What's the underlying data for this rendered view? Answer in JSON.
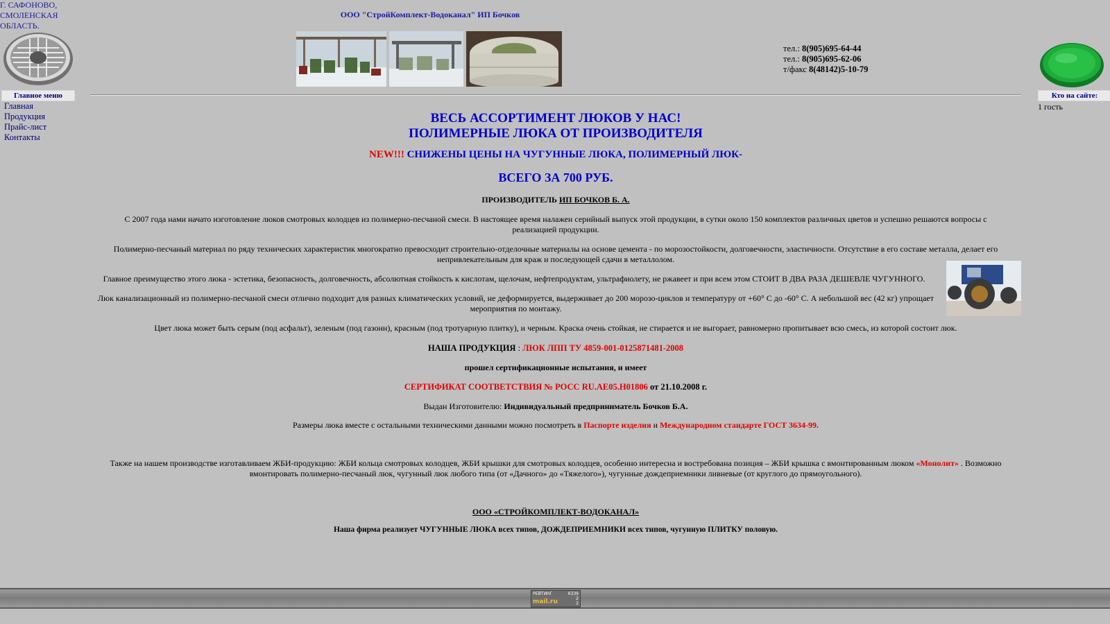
{
  "location": "Г. САФОНОВО, СМОЛЕНСКАЯ ОБЛАСТЬ.",
  "company_name": "ООО \"СтройКомплект-Водоканал\" ИП Бочков",
  "left_menu": {
    "heading": "Главное меню",
    "items": [
      "Главная",
      "Продукция",
      "Прайс-лист",
      "Контакты"
    ]
  },
  "contacts": [
    {
      "label": "тел.:",
      "value": "8(905)695-64-44"
    },
    {
      "label": "тел.:",
      "value": "8(905)695-62-06"
    },
    {
      "label": "т/факс",
      "value": "8(48142)5-10-79"
    }
  ],
  "right_panel": {
    "heading": "Кто на сайте:",
    "guests": "1 гость"
  },
  "main": {
    "headline1": "ВЕСЬ АССОРТИМЕНТ ЛЮКОВ У НАС!",
    "headline2": "ПОЛИМЕРНЫЕ ЛЮКА ОТ ПРОИЗВОДИТЕЛЯ",
    "new_tag": "NEW!!!",
    "new_text": " СНИЖЕНЫ ЦЕНЫ НА ЧУГУННЫЕ ЛЮКА, ПОЛИМЕРНЫЙ ЛЮК-",
    "price": "ВСЕГО ЗА 700 РУБ.",
    "producer_label": "ПРОИЗВОДИТЕЛЬ ",
    "producer_name": "ИП БОЧКОВ Б. А.",
    "para1": "С  2007 года нами начато изготовление люков смотровых колодцев из полимерно-песчаной смеси.   В  настоящее время налажен серийный выпуск этой продукции, в сутки около 150 комплектов различных цветов и  успешно решаются вопросы с реализацией продукции.",
    "para2": "Полимерно-песчаный материал по ряду технических характеристик многократно превосходит строительно-отделочные материалы на основе цемента - по морозостойкости, долговечности, эластичности. Отсутствие в его составе металла, делает его непривлекательным для краж и последующей сдачи в металлолом.",
    "para3": "Главное преимущество этого люка - эстетика, безопасность, долговечность, абсолютная стойкость к кислотам, щелочам, нефтепродуктам, ультрафиолету, не ржавеет и при всем этом СТОИТ В ДВА РАЗА ДЕШЕВЛЕ ЧУГУННОГО.",
    "para4": "Люк канализационный из полимерно-песчаной смеси отлично подходит для разных климатических условий, не деформируется, выдерживает до 200 морозо-циклов и  температуру от +60° С   до  -60° С. А небольшой вес (42 кг)  упрощает мероприятия по монтажу.",
    "para5": "Цвет люка может быть серым  (под асфальт), зеленым  (под газонн), красным (под тротуарную плитку), и черным. Краска очень стойкая, не стирается и не выгорает, равномерно пропитывает всю смесь, из которой состоит люк.",
    "product_label": "НАША ПРОДУКЦИЯ",
    "product_sep": " : ",
    "product_name": "ЛЮК  ЛПП  ТУ 4859-001-0125871481-2008",
    "cert_line": "прошел сертификационные испытания, и имеет",
    "cert_red": "СЕРТИФИКАТ СООТВЕТСТВИЯ № РОСС RU.АЕ05.Н01806",
    "cert_date": " от 21.10.2008 г.",
    "issued_label": "Выдан Изготовителю:  ",
    "issued_name": "Индивидуальный предприниматель Бочков Б.А.",
    "sizes_text": "Размеры люка вместе с остальными техническими данными можно посмотреть в ",
    "sizes_link1": "Паспорте изделия",
    "sizes_and": " и ",
    "sizes_link2": "Международном стандарте ГОСТ 3634-99.",
    "gbi_text1": "Также на нашем производстве изготавливаем ЖБИ-продукцию: ЖБИ кольца смотровых колодцев, ЖБИ крышки  для смотровых колодцев, особенно интересна и востребована позиция – ЖБИ крышка с вмонтированным люком ",
    "gbi_link": "«Монолит»",
    "gbi_text2": " . Возможно вмонтировать полимерно-песчаный люк, чугунный люк любого типа (от «Дачного» до «Тяжелого»), чугунные дождеприемники ливневые (от круглого до прямоугольного).",
    "firm_name": "ООО «СТРОЙКОМПЛЕКТ-ВОДОКАНАЛ»",
    "firm_text": "Наша фирма реализует ЧУГУННЫЕ ЛЮКА всех типов, ДОЖДЕПРИЕМНИКИ всех типов, чугунную ПЛИТКУ половую."
  },
  "counter": {
    "label": "РЕЙТИНГ",
    "number": "6339",
    "brand": "mail.ru",
    "n1": "2",
    "n2": "2"
  },
  "colors": {
    "background": "#c0c0c0",
    "link_blue": "#000080",
    "headline_blue": "#0000cc",
    "accent_red": "#e00000",
    "hatch_green": "#1faa3a"
  }
}
